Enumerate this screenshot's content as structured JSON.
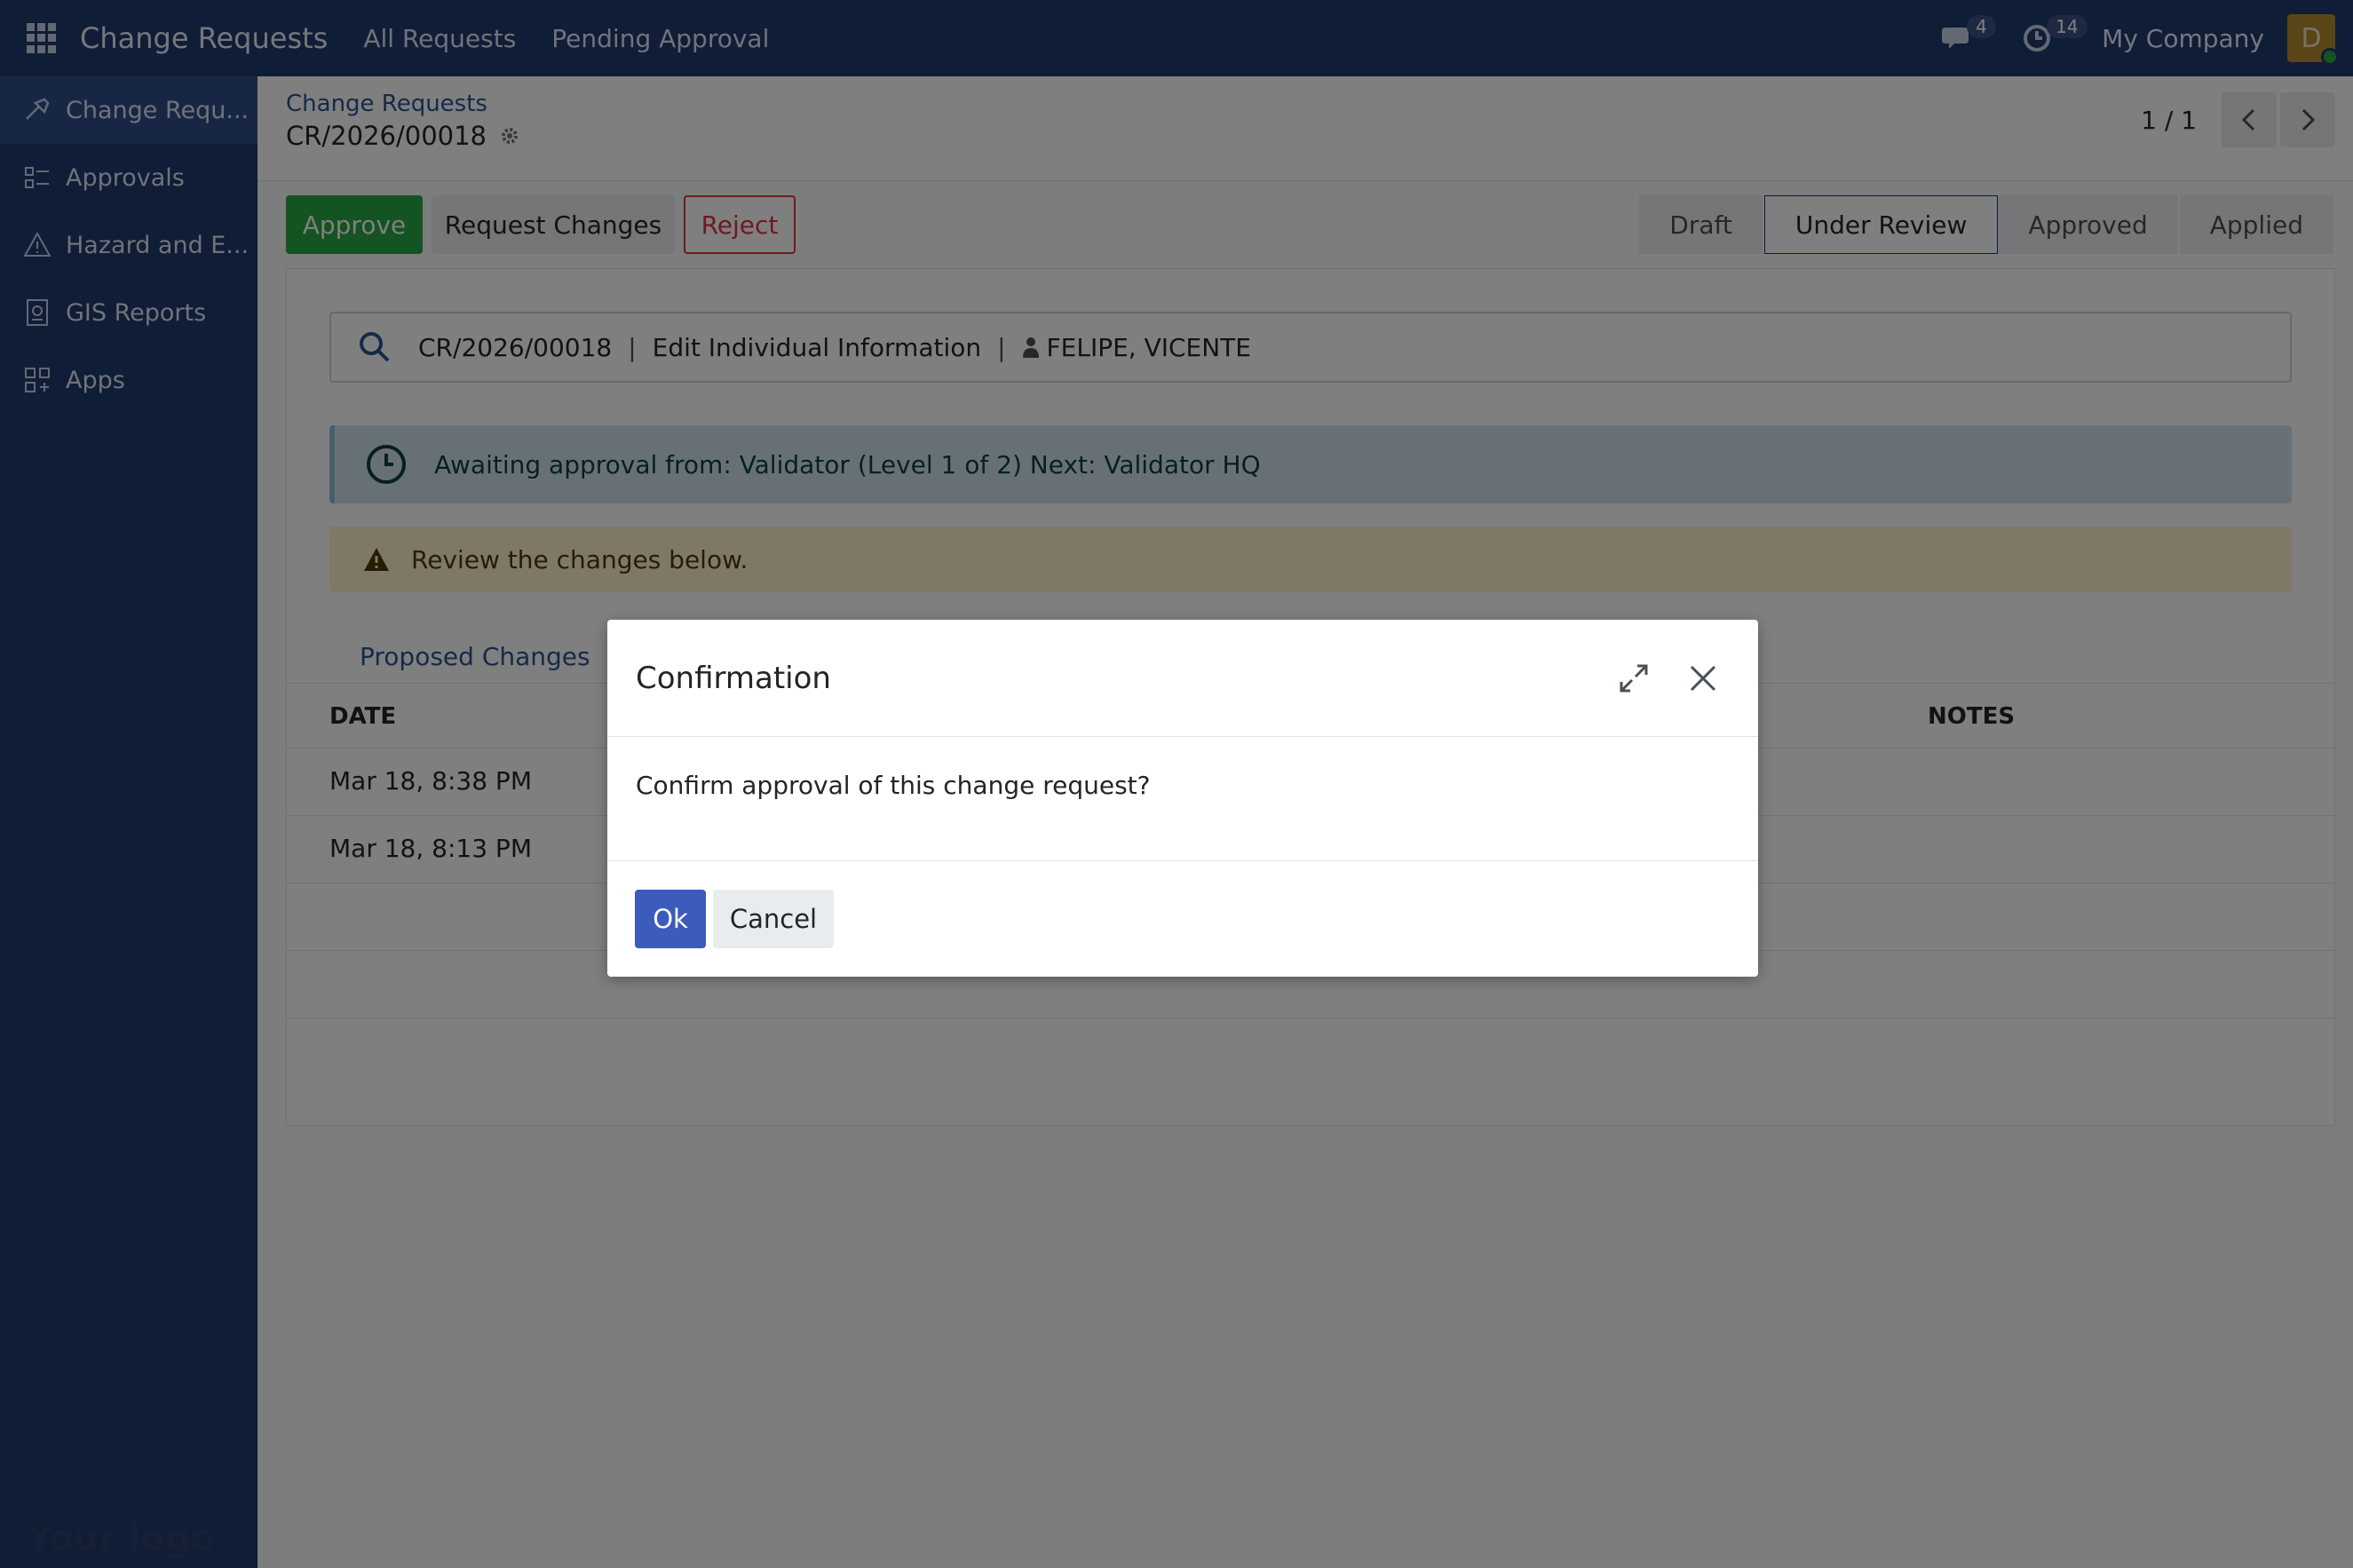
{
  "navbar": {
    "brand": "Change Requests",
    "links": [
      "All Requests",
      "Pending Approval"
    ],
    "messages_count": "4",
    "activities_count": "14",
    "company": "My Company",
    "avatar_initial": "D"
  },
  "sidebar": {
    "items": [
      {
        "label": "Change Requ...",
        "icon": "wrench-icon"
      },
      {
        "label": "Approvals",
        "icon": "approvals-icon"
      },
      {
        "label": "Hazard and E...",
        "icon": "warning-icon"
      },
      {
        "label": "GIS Reports",
        "icon": "report-icon"
      },
      {
        "label": "Apps",
        "icon": "apps-icon"
      }
    ],
    "logo_text": "Your logo"
  },
  "breadcrumb": {
    "parent": "Change Requests",
    "current": "CR/2026/00018"
  },
  "pager": {
    "value": "1 / 1"
  },
  "actions": {
    "approve": "Approve",
    "request_changes": "Request Changes",
    "reject": "Reject"
  },
  "stages": [
    "Draft",
    "Under Review",
    "Approved",
    "Applied"
  ],
  "summary": {
    "ref": "CR/2026/00018",
    "separator": "|",
    "type": "Edit Individual Information",
    "person": "FELIPE, VICENTE"
  },
  "alert_info": "Awaiting approval from: Validator (Level 1 of 2) Next: Validator HQ",
  "alert_warning": "Review the changes below.",
  "tabs": [
    "Proposed Changes"
  ],
  "table": {
    "headers": [
      "DATE",
      "NOTES"
    ],
    "rows": [
      "Mar 18, 8:38 PM",
      "Mar 18, 8:13 PM"
    ]
  },
  "modal": {
    "title": "Confirmation",
    "body": "Confirm approval of this change request?",
    "ok": "Ok",
    "cancel": "Cancel"
  },
  "colors": {
    "navbar": "#1f3a6e",
    "approve": "#28a745",
    "reject": "#dc3545",
    "primary": "#3b5bbd"
  }
}
